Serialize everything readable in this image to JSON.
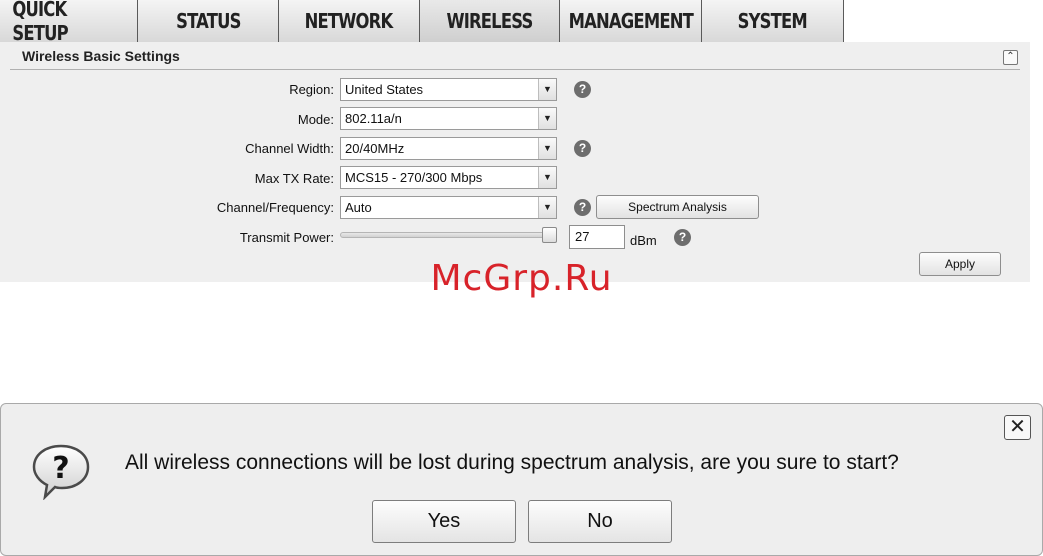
{
  "nav": {
    "tabs": [
      {
        "label": "QUICK SETUP"
      },
      {
        "label": "STATUS"
      },
      {
        "label": "NETWORK"
      },
      {
        "label": "WIRELESS",
        "active": true
      },
      {
        "label": "MANAGEMENT"
      },
      {
        "label": "SYSTEM"
      }
    ]
  },
  "panel": {
    "title": "Wireless Basic Settings",
    "collapse_icon": "double-chevron-up-icon",
    "region": {
      "label": "Region:",
      "value": "United States"
    },
    "mode": {
      "label": "Mode:",
      "value": "802.11a/n"
    },
    "channel_width": {
      "label": "Channel Width:",
      "value": "20/40MHz"
    },
    "max_tx_rate": {
      "label": "Max TX Rate:",
      "value": "MCS15 - 270/300 Mbps"
    },
    "channel_frequency": {
      "label": "Channel/Frequency:",
      "value": "Auto",
      "button": "Spectrum Analysis"
    },
    "transmit_power": {
      "label": "Transmit Power:",
      "value": "27",
      "unit": "dBm",
      "slider_level": 1.0
    },
    "apply_label": "Apply",
    "help_glyph": "?"
  },
  "watermark": "McGrp.Ru",
  "dialog": {
    "message": "All wireless connections will be lost during spectrum analysis, are you sure to start?",
    "yes_label": "Yes",
    "no_label": "No",
    "close_glyph": "✕",
    "icon": "question-bubble-icon"
  },
  "colors": {
    "nav_bg": "#1c1c1c",
    "panel_bg": "#efefef",
    "watermark": "#d8232a"
  }
}
